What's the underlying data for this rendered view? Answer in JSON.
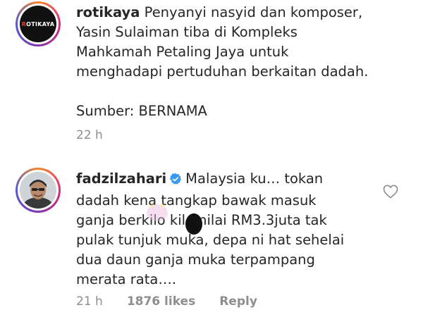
{
  "comments": [
    {
      "username": "rotikaya",
      "avatar_logo": "ROTIKAYA",
      "text": "Penyanyi nasyid dan komposer,\nYasin Sulaiman tiba di Kompleks\nMahkamah Petaling Jaya untuk\nmenghadapi pertuduhan berkaitan dadah.",
      "source": "Sumber: BERNAMA",
      "time": "22 h"
    },
    {
      "username": "fadzilzahari",
      "verified": true,
      "text": "Malaysia ku… tokan\ndadah kena tangkap bawak masuk\nganja berkilo kilo nilai RM3.3juta tak\npulak tunjuk muka, depa ni hat sehelai\ndua daun ganja muka terpampang\nmerata rata….",
      "time": "21 h",
      "likes": "1876 likes",
      "reply_label": "Reply"
    }
  ],
  "icons": {
    "verified": "verified-badge-icon",
    "like": "heart-icon"
  },
  "colors": {
    "text": "#262626",
    "meta": "#8e8e8e",
    "verified_blue": "#3897f0"
  }
}
